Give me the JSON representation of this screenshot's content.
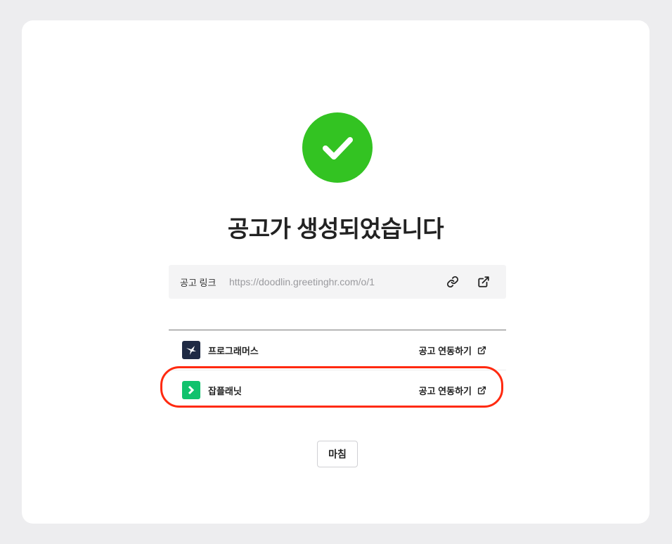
{
  "dialog": {
    "title": "공고가 생성되었습니다",
    "status_color": "#33c322"
  },
  "link": {
    "label": "공고 링크",
    "url": "https://doodlin.greetinghr.com/o/1"
  },
  "platforms": [
    {
      "name": "프로그래머스",
      "action_label": "공고 연동하기",
      "logo_icon": "programmers-logo-icon"
    },
    {
      "name": "잡플래닛",
      "action_label": "공고 연동하기",
      "logo_icon": "jobplanet-logo-icon",
      "highlighted": true
    }
  ],
  "footer": {
    "done_label": "마침"
  },
  "colors": {
    "highlight": "#ff2a10",
    "programmers_brand": "#1f2a44",
    "jobplanet_brand": "#11c26d"
  }
}
